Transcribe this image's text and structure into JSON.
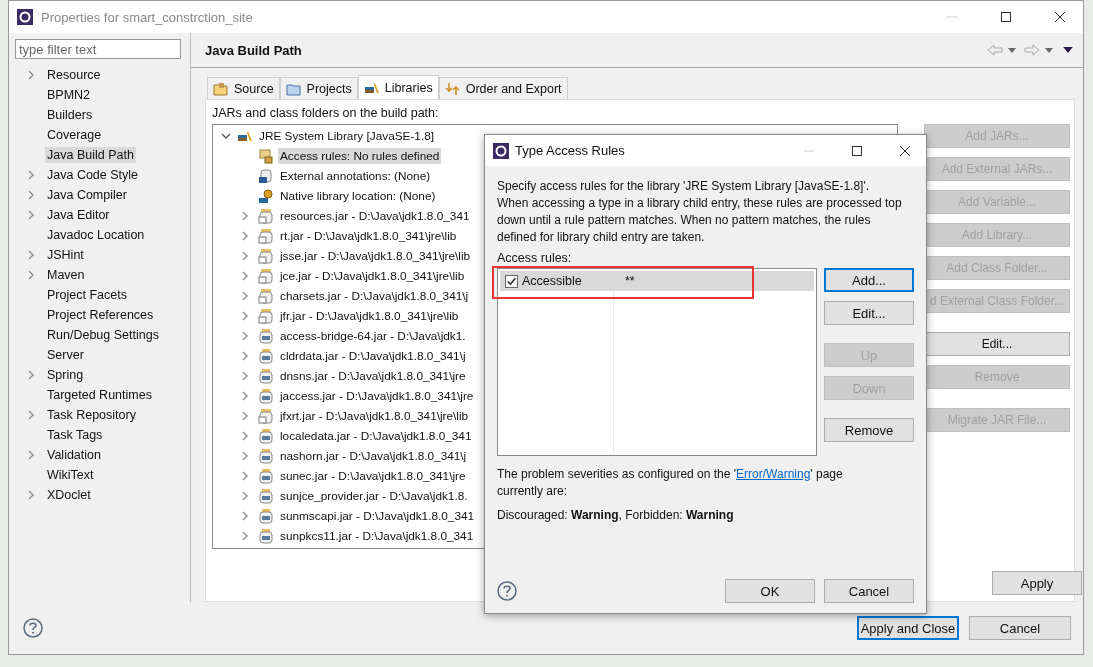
{
  "window": {
    "title": "Properties for smart_constrction_site"
  },
  "filter": {
    "placeholder": "type filter text"
  },
  "sidebar": {
    "items": [
      {
        "label": "Resource",
        "expandable": true,
        "selected": false
      },
      {
        "label": "BPMN2",
        "expandable": false,
        "selected": false
      },
      {
        "label": "Builders",
        "expandable": false,
        "selected": false
      },
      {
        "label": "Coverage",
        "expandable": false,
        "selected": false
      },
      {
        "label": "Java Build Path",
        "expandable": false,
        "selected": true
      },
      {
        "label": "Java Code Style",
        "expandable": true,
        "selected": false
      },
      {
        "label": "Java Compiler",
        "expandable": true,
        "selected": false
      },
      {
        "label": "Java Editor",
        "expandable": true,
        "selected": false
      },
      {
        "label": "Javadoc Location",
        "expandable": false,
        "selected": false
      },
      {
        "label": "JSHint",
        "expandable": true,
        "selected": false
      },
      {
        "label": "Maven",
        "expandable": true,
        "selected": false
      },
      {
        "label": "Project Facets",
        "expandable": false,
        "selected": false
      },
      {
        "label": "Project References",
        "expandable": false,
        "selected": false
      },
      {
        "label": "Run/Debug Settings",
        "expandable": false,
        "selected": false
      },
      {
        "label": "Server",
        "expandable": false,
        "selected": false
      },
      {
        "label": "Spring",
        "expandable": true,
        "selected": false
      },
      {
        "label": "Targeted Runtimes",
        "expandable": false,
        "selected": false
      },
      {
        "label": "Task Repository",
        "expandable": true,
        "selected": false
      },
      {
        "label": "Task Tags",
        "expandable": false,
        "selected": false
      },
      {
        "label": "Validation",
        "expandable": true,
        "selected": false
      },
      {
        "label": "WikiText",
        "expandable": false,
        "selected": false
      },
      {
        "label": "XDoclet",
        "expandable": true,
        "selected": false
      }
    ]
  },
  "page": {
    "title": "Java Build Path"
  },
  "tabs": [
    {
      "label": "Source",
      "selected": false,
      "kind": "source"
    },
    {
      "label": "Projects",
      "selected": false,
      "kind": "projects"
    },
    {
      "label": "Libraries",
      "selected": true,
      "kind": "libraries"
    },
    {
      "label": "Order and Export",
      "selected": false,
      "kind": "order"
    }
  ],
  "build_path_label": "JARs and class folders on the build path:",
  "tree": [
    {
      "label": "JRE System Library [JavaSE-1.8]",
      "expanded": true,
      "children": [
        {
          "label": "Access rules: No rules defined",
          "kind": "access",
          "selected": true,
          "expandable": false
        },
        {
          "label": "External annotations: (None)",
          "kind": "annotation",
          "selected": false,
          "expandable": false
        },
        {
          "label": "Native library location: (None)",
          "kind": "native",
          "selected": false,
          "expandable": false
        },
        {
          "label": "resources.jar - D:\\Java\\jdk1.8.0_341",
          "kind": "jar-src",
          "selected": false,
          "expandable": true
        },
        {
          "label": "rt.jar - D:\\Java\\jdk1.8.0_341\\jre\\lib",
          "kind": "jar-src",
          "selected": false,
          "expandable": true
        },
        {
          "label": "jsse.jar - D:\\Java\\jdk1.8.0_341\\jre\\lib",
          "kind": "jar-src",
          "selected": false,
          "expandable": true
        },
        {
          "label": "jce.jar - D:\\Java\\jdk1.8.0_341\\jre\\lib",
          "kind": "jar-src",
          "selected": false,
          "expandable": true
        },
        {
          "label": "charsets.jar - D:\\Java\\jdk1.8.0_341\\j",
          "kind": "jar-src",
          "selected": false,
          "expandable": true
        },
        {
          "label": "jfr.jar - D:\\Java\\jdk1.8.0_341\\jre\\lib",
          "kind": "jar-src",
          "selected": false,
          "expandable": true
        },
        {
          "label": "access-bridge-64.jar - D:\\Java\\jdk1.",
          "kind": "jar",
          "selected": false,
          "expandable": true
        },
        {
          "label": "cldrdata.jar - D:\\Java\\jdk1.8.0_341\\j",
          "kind": "jar",
          "selected": false,
          "expandable": true
        },
        {
          "label": "dnsns.jar - D:\\Java\\jdk1.8.0_341\\jre",
          "kind": "jar",
          "selected": false,
          "expandable": true
        },
        {
          "label": "jaccess.jar - D:\\Java\\jdk1.8.0_341\\jre",
          "kind": "jar",
          "selected": false,
          "expandable": true
        },
        {
          "label": "jfxrt.jar - D:\\Java\\jdk1.8.0_341\\jre\\lib",
          "kind": "jar-src",
          "selected": false,
          "expandable": true
        },
        {
          "label": "localedata.jar - D:\\Java\\jdk1.8.0_341",
          "kind": "jar",
          "selected": false,
          "expandable": true
        },
        {
          "label": "nashorn.jar - D:\\Java\\jdk1.8.0_341\\j",
          "kind": "jar",
          "selected": false,
          "expandable": true
        },
        {
          "label": "sunec.jar - D:\\Java\\jdk1.8.0_341\\jre",
          "kind": "jar",
          "selected": false,
          "expandable": true
        },
        {
          "label": "sunjce_provider.jar - D:\\Java\\jdk1.8.",
          "kind": "jar",
          "selected": false,
          "expandable": true
        },
        {
          "label": "sunmscapi.jar - D:\\Java\\jdk1.8.0_341",
          "kind": "jar",
          "selected": false,
          "expandable": true
        },
        {
          "label": "sunpkcs11.jar - D:\\Java\\jdk1.8.0_341",
          "kind": "jar",
          "selected": false,
          "expandable": true
        }
      ]
    }
  ],
  "side_buttons": [
    {
      "label": "Add JARs...",
      "disabled": true
    },
    {
      "label": "Add External JARs...",
      "disabled": true
    },
    {
      "label": "Add Variable...",
      "disabled": true
    },
    {
      "label": "Add Library...",
      "disabled": true
    },
    {
      "label": "Add Class Folder...",
      "disabled": true
    },
    {
      "label": "d External Class Folder...",
      "disabled": true
    },
    {
      "label": "Edit...",
      "disabled": false
    },
    {
      "label": "Remove",
      "disabled": true
    },
    {
      "label": "Migrate JAR File...",
      "disabled": true
    }
  ],
  "apply_button": "Apply",
  "footer_buttons": [
    {
      "label": "Apply and Close",
      "default": true
    },
    {
      "label": "Cancel",
      "default": false
    }
  ],
  "dialog": {
    "title": "Type Access Rules",
    "description": "Specify access rules for the library 'JRE System Library [JavaSE-1.8]'. When accessing a type in a library child entry, these rules are processed top down until a rule pattern matches. When no pattern matches, the rules defined for library child entry are taken.",
    "rules_label": "Access rules:",
    "rules": [
      {
        "kind_label": "Accessible",
        "pattern": "**",
        "checked": true,
        "selected": true
      }
    ],
    "buttons": [
      {
        "label": "Add...",
        "disabled": false,
        "default": true
      },
      {
        "label": "Edit...",
        "disabled": false,
        "default": false
      },
      {
        "label": "Up",
        "disabled": true,
        "default": false
      },
      {
        "label": "Down",
        "disabled": true,
        "default": false
      },
      {
        "label": "Remove",
        "disabled": false,
        "default": false
      }
    ],
    "severity_before": "The problem severities as configured on the '",
    "severity_link": "Error/Warning",
    "severity_after": "' page currently are:",
    "severity_values": "Discouraged: **Warning**, Forbidden: **Warning**",
    "footer_buttons": [
      {
        "label": "OK"
      },
      {
        "label": "Cancel"
      }
    ]
  }
}
